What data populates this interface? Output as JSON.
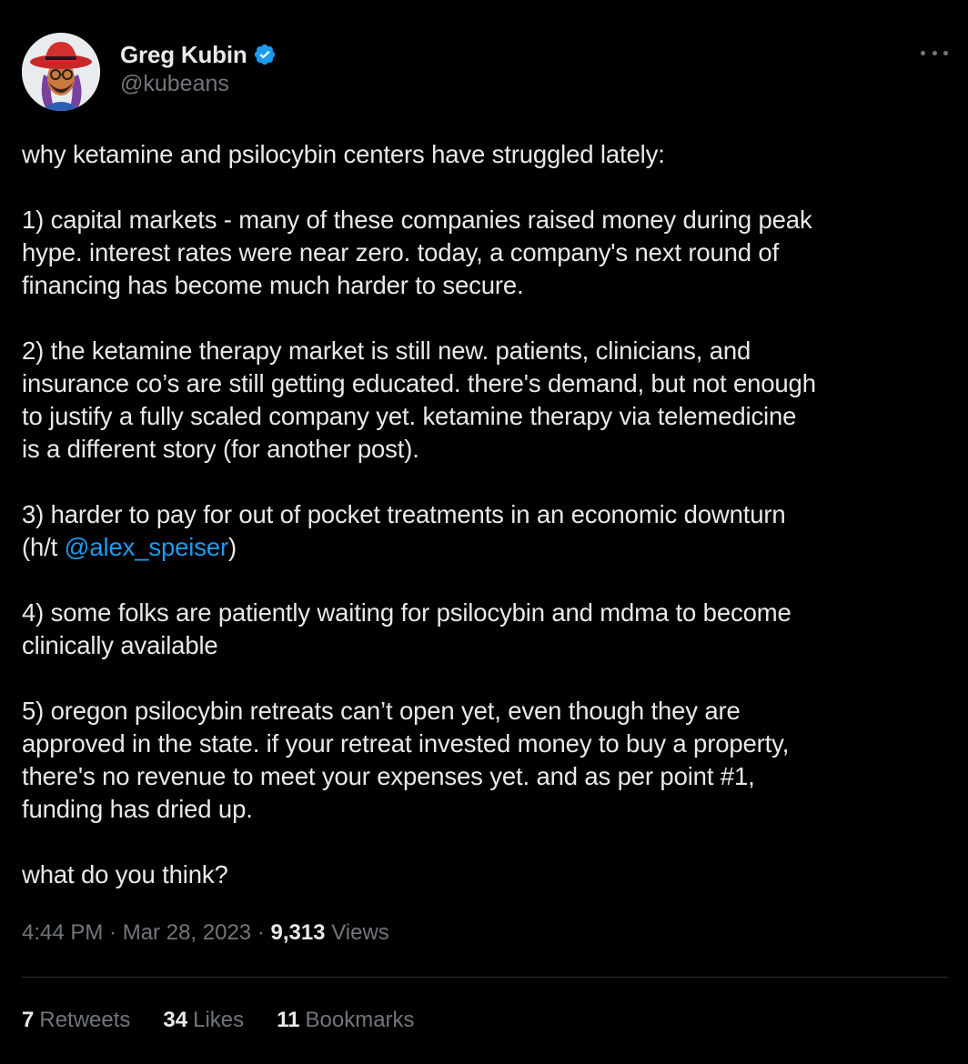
{
  "author": {
    "display_name": "Greg Kubin",
    "handle": "@kubeans",
    "verified_icon": "verified-badge-icon",
    "badge_color": "#1d9bf0"
  },
  "menu_icon": "more-options-icon",
  "tweet": {
    "paragraphs": [
      [
        "why ketamine and psilocybin centers have struggled lately:"
      ],
      [
        "1) capital markets - many of these companies raised money during peak",
        "hype. interest rates were near zero. today, a company's next round of",
        "financing has become much harder to secure."
      ],
      [
        "2) the ketamine therapy market is still new. patients, clinicians, and",
        "insurance co’s are still getting educated. there's demand, but not enough",
        "to justify a fully scaled company yet. ketamine therapy via telemedicine",
        "is a different story (for another post)."
      ],
      [
        "3) harder to pay for out of pocket treatments in an economic downturn"
      ],
      [
        "4) some folks are patiently waiting for psilocybin and mdma to become",
        "clinically available"
      ],
      [
        "5) oregon psilocybin retreats can’t open yet, even though they are",
        "approved in the state. if your retreat invested money to buy a property,",
        "there's no revenue to meet your expenses yet. and as per point #1,",
        "funding has dried up."
      ],
      [
        "what do you think?"
      ]
    ],
    "ht_prefix": "(h/t ",
    "mention": "@alex_speiser",
    "ht_suffix": ")",
    "mention_color": "#1d9bf0"
  },
  "meta": {
    "time": "4:44 PM",
    "separator": " · ",
    "date": "Mar 28, 2023",
    "views_count": "9,313",
    "views_label": "Views"
  },
  "stats": {
    "retweets_count": "7",
    "retweets_label": "Retweets",
    "likes_count": "34",
    "likes_label": "Likes",
    "bookmarks_count": "11",
    "bookmarks_label": "Bookmarks"
  }
}
